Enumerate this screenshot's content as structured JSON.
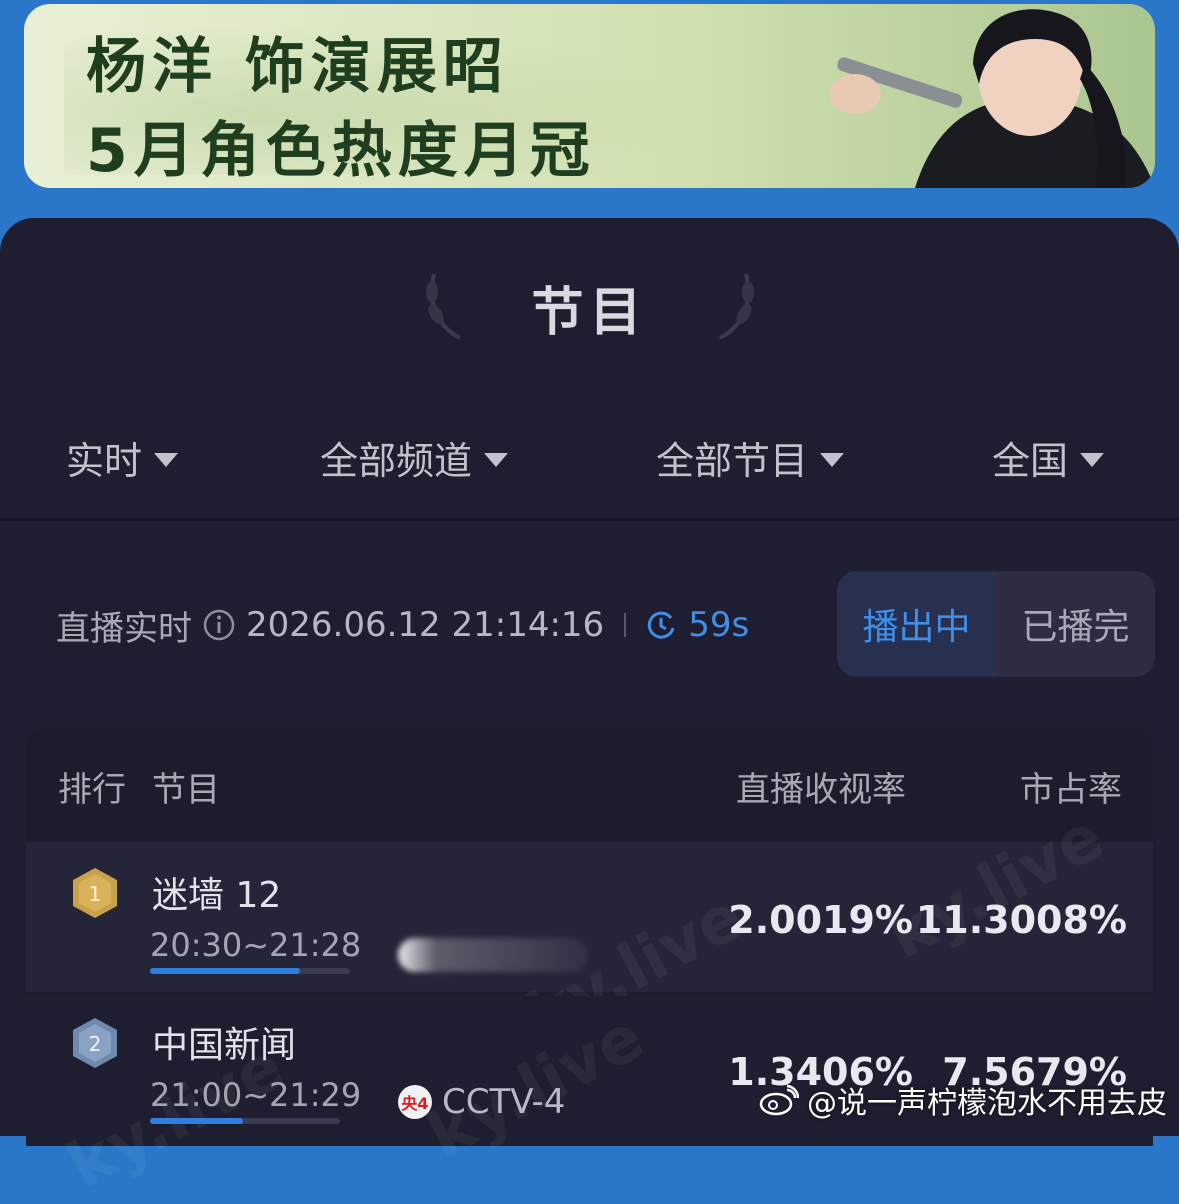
{
  "banner": {
    "line1": "杨洋 饰演展昭",
    "line2": "5月角色热度月冠"
  },
  "section": {
    "title": "节目"
  },
  "filters": [
    {
      "label": "实时"
    },
    {
      "label": "全部频道"
    },
    {
      "label": "全部节目"
    },
    {
      "label": "全国"
    }
  ],
  "status": {
    "label": "直播实时",
    "timestamp": "2026.06.12 21:14:16",
    "countdown": "59s"
  },
  "segment": {
    "active": "播出中",
    "inactive": "已播完"
  },
  "table": {
    "headers": {
      "rank": "排行",
      "program": "节目",
      "rating": "直播收视率",
      "share": "市占率"
    },
    "rows": [
      {
        "rank": "1",
        "name": "迷墙 12",
        "time": "20:30~21:28",
        "progress": 0.75,
        "channel": "",
        "rating": "2.0019%",
        "share": "11.3008%"
      },
      {
        "rank": "2",
        "name": "中国新闻",
        "time": "21:00~21:29",
        "progress": 0.49,
        "channel_logo": "央4",
        "channel": "CCTV-4",
        "rating": "1.3406%",
        "share": "7.5679%"
      }
    ]
  },
  "watermark": "ky.live",
  "weibo": {
    "handle": "@说一声柠檬泡水不用去皮"
  },
  "colors": {
    "accent": "#3f8ee8",
    "card_bg": "#1e1e30",
    "medal_gold": "#c9a14a",
    "medal_silver": "#7b96b8"
  }
}
